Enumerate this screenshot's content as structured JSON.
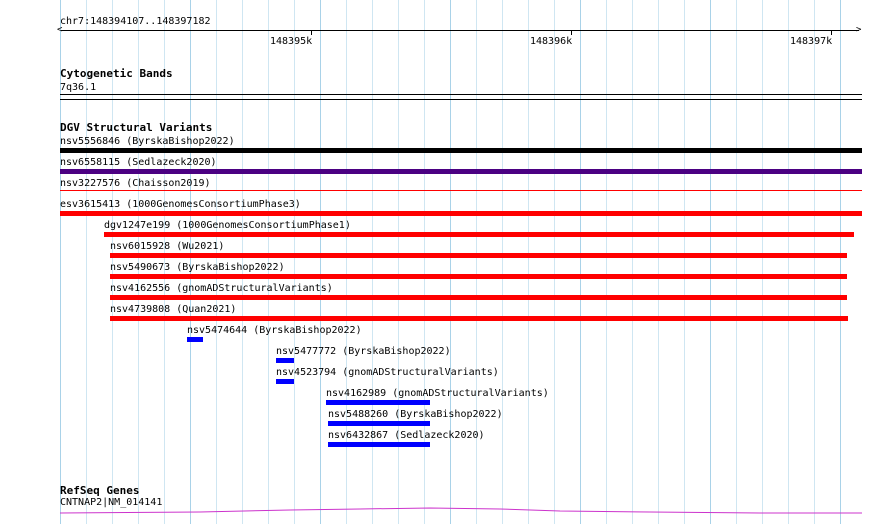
{
  "ruler": {
    "location": "chr7:148394107..148397182",
    "labels": [
      "148395k",
      "148396k",
      "148397k"
    ]
  },
  "cytoband": {
    "title": "Cytogenetic Bands",
    "band": "7q36.1"
  },
  "dgv": {
    "title": "DGV Structural Variants",
    "colors": {
      "black": "#000000",
      "purple": "#4b0082",
      "red": "#ff0000",
      "blue": "#0000ff"
    },
    "variants": [
      {
        "label": "nsv5556846 (ByrskaBishop2022)",
        "color": "#000000"
      },
      {
        "label": "nsv6558115 (Sedlazeck2020)",
        "color": "#4b0082"
      },
      {
        "label": "nsv3227576 (Chaisson2019)",
        "color": "#ff0000"
      },
      {
        "label": "esv3615413 (1000GenomesConsortiumPhase3)",
        "color": "#ff0000"
      },
      {
        "label": "dgv1247e199 (1000GenomesConsortiumPhase1)",
        "color": "#ff0000"
      },
      {
        "label": "nsv6015928 (Wu2021)",
        "color": "#ff0000"
      },
      {
        "label": "nsv5490673 (ByrskaBishop2022)",
        "color": "#ff0000"
      },
      {
        "label": "nsv4162556 (gnomADStructuralVariants)",
        "color": "#ff0000"
      },
      {
        "label": "nsv4739808 (Quan2021)",
        "color": "#ff0000"
      },
      {
        "label": "nsv5474644 (ByrskaBishop2022)",
        "color": "#0000ff"
      },
      {
        "label": "nsv5477772 (ByrskaBishop2022)",
        "color": "#0000ff"
      },
      {
        "label": "nsv4523794 (gnomADStructuralVariants)",
        "color": "#0000ff"
      },
      {
        "label": "nsv4162989 (gnomADStructuralVariants)",
        "color": "#0000ff"
      },
      {
        "label": "nsv5488260 (ByrskaBishop2022)",
        "color": "#0000ff"
      },
      {
        "label": "nsv6432867 (Sedlazeck2020)",
        "color": "#0000ff"
      }
    ]
  },
  "refseq": {
    "title": "RefSeq Genes",
    "gene": "CNTNAP2|NM_014141",
    "color": "#cc33cc"
  }
}
